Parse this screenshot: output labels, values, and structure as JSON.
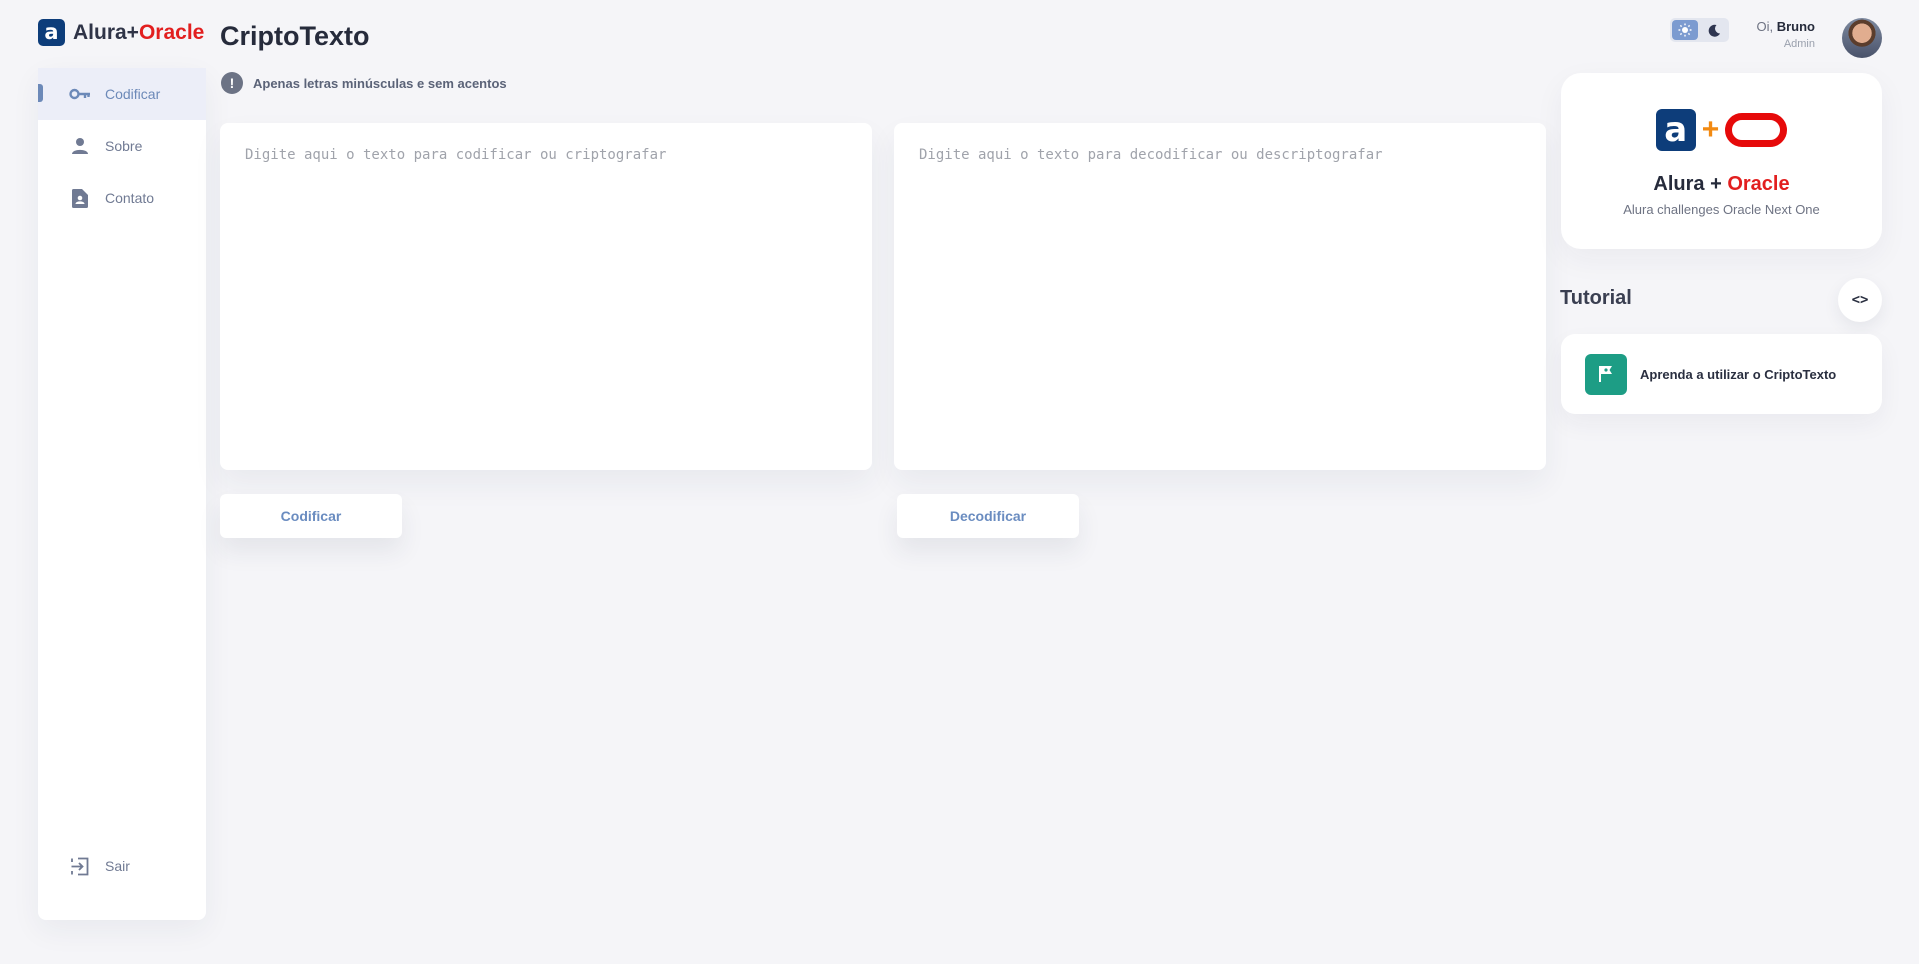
{
  "brand": {
    "name_part1": "Alura+",
    "name_part2": "Oracle",
    "mark": "a"
  },
  "page": {
    "title": "CriptoTexto"
  },
  "sidebar": {
    "items": [
      {
        "label": "Codificar",
        "icon": "key-icon",
        "active": true
      },
      {
        "label": "Sobre",
        "icon": "user-icon",
        "active": false
      },
      {
        "label": "Contato",
        "icon": "contact-card-icon",
        "active": false
      }
    ],
    "logout": {
      "label": "Sair",
      "icon": "logout-icon"
    }
  },
  "notice": {
    "icon_text": "!",
    "text": "Apenas letras minúsculas e sem acentos"
  },
  "encoder": {
    "placeholder": "Digite aqui o texto para codificar ou criptografar",
    "value": ""
  },
  "decoder": {
    "placeholder": "Digite aqui o texto para decodificar ou descriptografar",
    "value": ""
  },
  "actions": {
    "encode_label": "Codificar",
    "decode_label": "Decodificar"
  },
  "user": {
    "greeting": "Oi,",
    "name": "Bruno",
    "role": "Admin"
  },
  "theme": {
    "light_icon": "sun-icon",
    "dark_icon": "moon-icon",
    "selected": "light"
  },
  "brand_card": {
    "logo_a": "a",
    "logo_plus": "+",
    "title_part1": "Alura + ",
    "title_part2": "Oracle",
    "subtitle": "Alura challenges Oracle Next One"
  },
  "tutorial": {
    "heading": "Tutorial",
    "toggle_label": "<>",
    "item_label": "Aprenda a utilizar o CriptoTexto",
    "item_icon": "flag-icon"
  },
  "colors": {
    "accent": "#6c89b8",
    "brand_blue": "#0d3d7a",
    "oracle_red": "#e21f1f",
    "tutorial_green": "#1d9d85"
  }
}
